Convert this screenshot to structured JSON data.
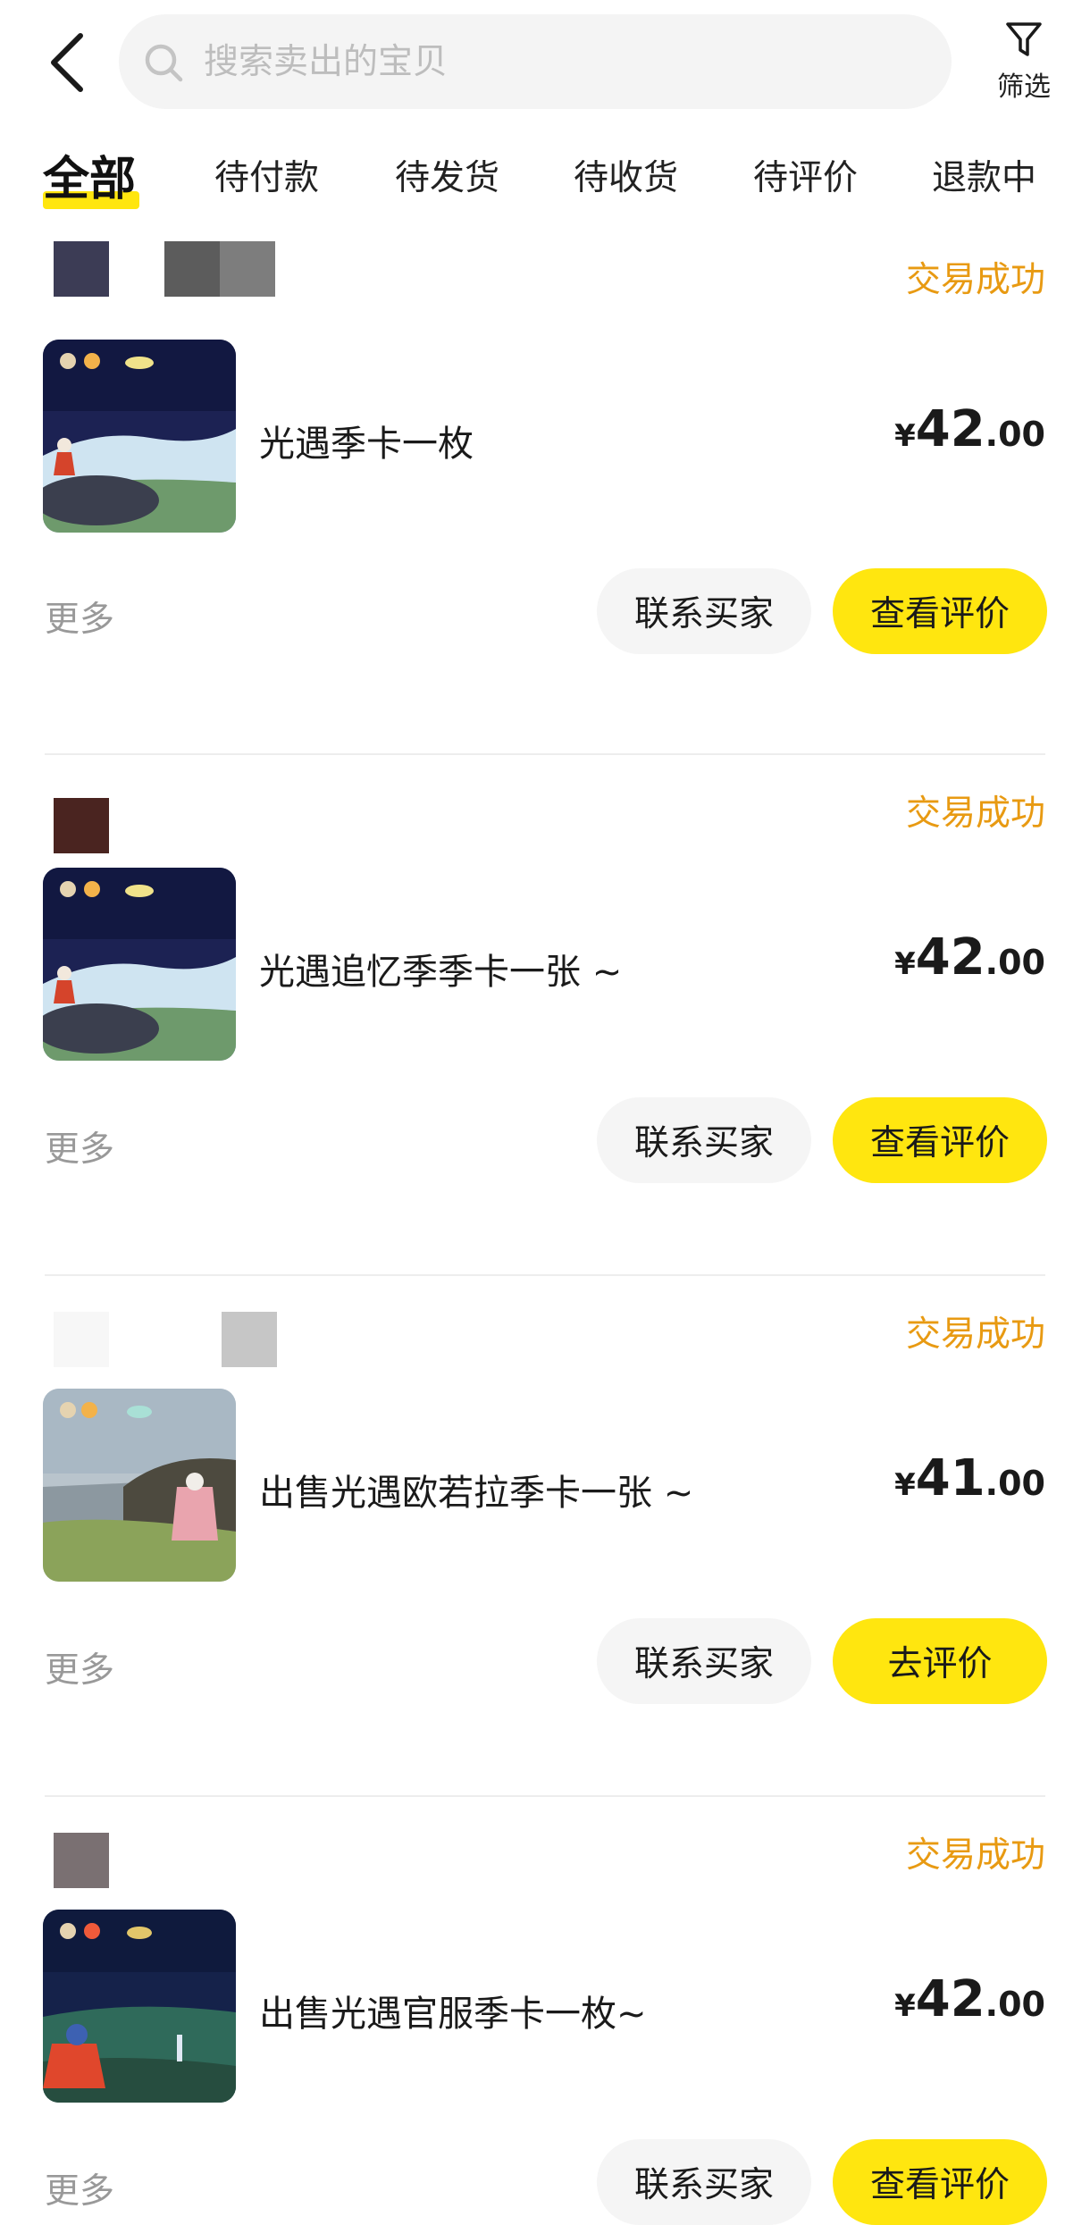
{
  "header": {
    "search_placeholder": "搜索卖出的宝贝",
    "filter_label": "筛选"
  },
  "tabs": [
    {
      "label": "全部",
      "active": true
    },
    {
      "label": "待付款",
      "active": false
    },
    {
      "label": "待发货",
      "active": false
    },
    {
      "label": "待收货",
      "active": false
    },
    {
      "label": "待评价",
      "active": false
    },
    {
      "label": "退款中",
      "active": false
    }
  ],
  "orders": [
    {
      "status": "交易成功",
      "title": "光遇季卡一枚",
      "price": {
        "currency": "¥",
        "int": "42",
        "dec": ".00"
      },
      "more": "更多",
      "contact": "联系买家",
      "action": "查看评价"
    },
    {
      "status": "交易成功",
      "title": "光遇追忆季季卡一张 ~",
      "price": {
        "currency": "¥",
        "int": "42",
        "dec": ".00"
      },
      "more": "更多",
      "contact": "联系买家",
      "action": "查看评价"
    },
    {
      "status": "交易成功",
      "title": "出售光遇欧若拉季卡一张 ~",
      "price": {
        "currency": "¥",
        "int": "41",
        "dec": ".00"
      },
      "more": "更多",
      "contact": "联系买家",
      "action": "去评价"
    },
    {
      "status": "交易成功",
      "title": "出售光遇官服季卡一枚~",
      "price": {
        "currency": "¥",
        "int": "42",
        "dec": ".00"
      },
      "more": "更多",
      "contact": "联系买家",
      "action": "查看评价"
    }
  ],
  "icons": {
    "back": "chevron-left-icon",
    "search": "search-icon",
    "filter": "filter-funnel-icon"
  },
  "colors": {
    "accent_yellow": "#ffe60f",
    "status_orange": "#e89a12",
    "muted_gray": "#999999"
  }
}
